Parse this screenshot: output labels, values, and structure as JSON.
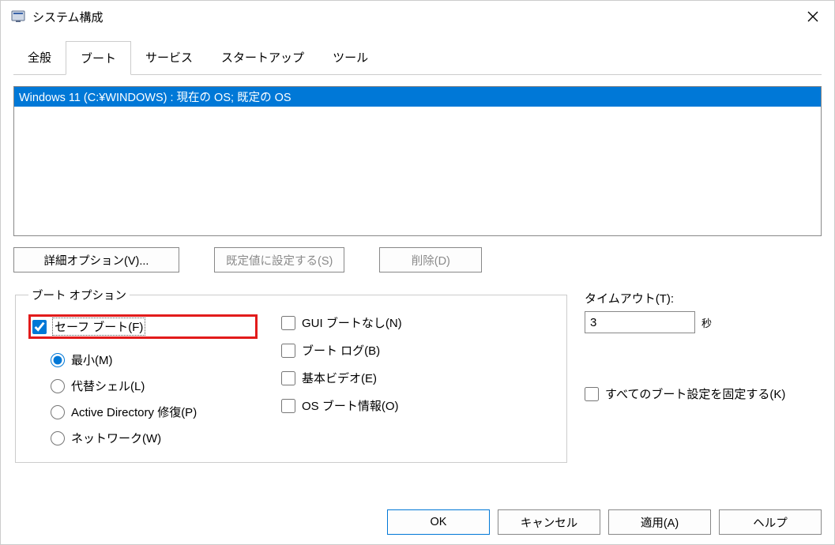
{
  "window": {
    "title": "システム構成"
  },
  "tabs": {
    "general": "全般",
    "boot": "ブート",
    "services": "サービス",
    "startup": "スタートアップ",
    "tools": "ツール"
  },
  "bootlist": {
    "item0": "Windows 11 (C:¥WINDOWS) : 現在の OS; 既定の OS"
  },
  "buttons": {
    "advanced": "詳細オプション(V)...",
    "setdefault": "既定値に設定する(S)",
    "delete": "削除(D)",
    "ok": "OK",
    "cancel": "キャンセル",
    "apply": "適用(A)",
    "help": "ヘルプ"
  },
  "group": {
    "boot_options": "ブート オプション"
  },
  "options": {
    "safeboot": "セーフ ブート(F)",
    "minimal": "最小(M)",
    "altshell": "代替シェル(L)",
    "adrepair": "Active Directory 修復(P)",
    "network": "ネットワーク(W)",
    "nogui": "GUI ブートなし(N)",
    "bootlog": "ブート ログ(B)",
    "basevideo": "基本ビデオ(E)",
    "osbootinfo": "OS ブート情報(O)",
    "makepermanent": "すべてのブート設定を固定する(K)"
  },
  "timeout": {
    "label": "タイムアウト(T):",
    "value": "3",
    "unit": "秒"
  }
}
